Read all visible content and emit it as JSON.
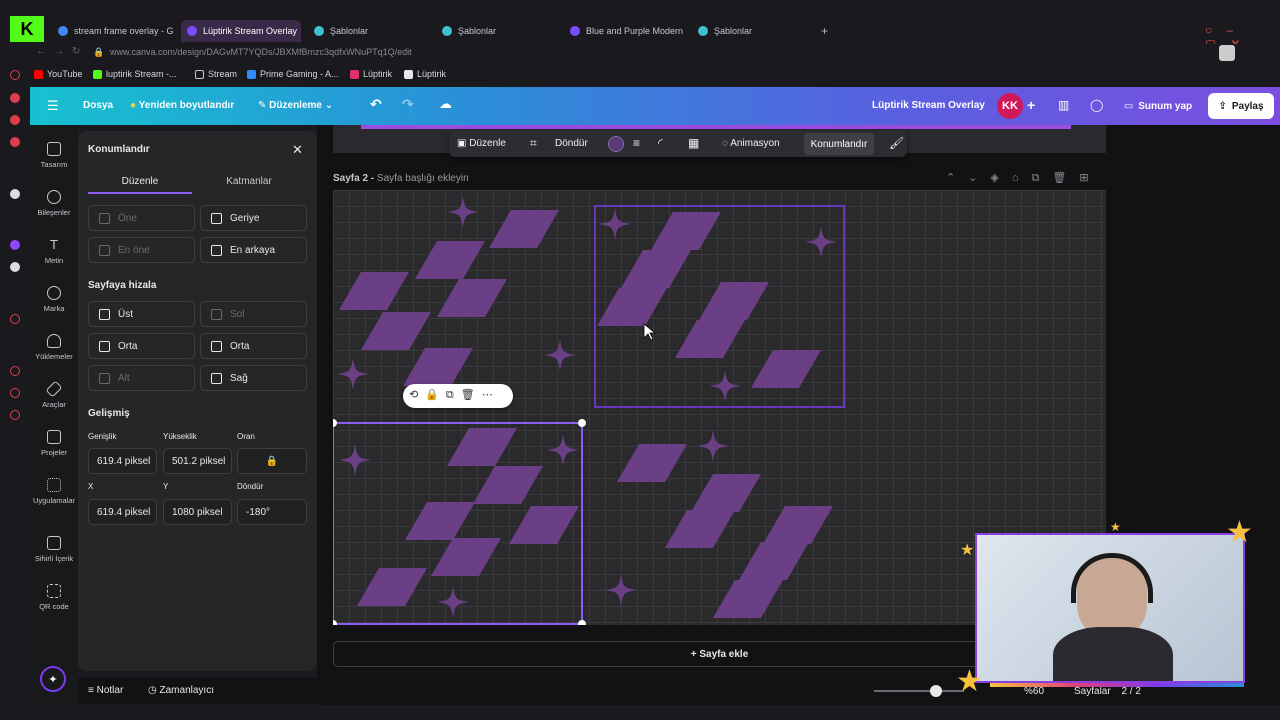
{
  "browser": {
    "tabs": [
      {
        "label": "stream frame overlay - G",
        "color": "#4285f4"
      },
      {
        "label": "Lüptirik Stream Overlay",
        "color": "#7c4dff",
        "active": true
      },
      {
        "label": "Şablonlar",
        "color": "#3fc1d3"
      },
      {
        "label": "Şablonlar",
        "color": "#3fc1d3"
      },
      {
        "label": "Blue and Purple Modern",
        "color": "#7c4dff"
      },
      {
        "label": "Şablonlar",
        "color": "#3fc1d3"
      }
    ],
    "url": "www.canva.com/design/DAGvMT7YQDs/JBXMfBmzc3qdfxWNuPTq1Q/edit",
    "bookmarks": [
      {
        "label": "YouTube",
        "color": "#ff0000"
      },
      {
        "label": "luptirik Stream -...",
        "color": "#53fc18"
      },
      {
        "label": "Stream",
        "color": "#c8c8cc"
      },
      {
        "label": "Prime Gaming - A...",
        "color": "#2e8cff"
      },
      {
        "label": "Lüptirik",
        "color": "#e1306c"
      },
      {
        "label": "Lüptirik",
        "color": "#e8e8ea"
      }
    ]
  },
  "canva": {
    "menu": {
      "file": "Dosya",
      "resize": "Yeniden boyutlandır",
      "editing": "Düzenleme"
    },
    "design_title": "Lüptirik Stream Overlay",
    "avatar": "KK",
    "present": "Sunum yap",
    "share": "Paylaş",
    "nav": [
      "Tasarım",
      "Bileşenler",
      "Metin",
      "Marka",
      "Yüklemeler",
      "Araçlar",
      "Projeler",
      "Uygulamalar",
      "Sihirli İçerik",
      "QR code"
    ],
    "toolbar": {
      "edit": "Düzenle",
      "rotate": "Döndür",
      "animate": "Animasyon",
      "position": "Konumlandır",
      "fill_color": "#5b3a78"
    },
    "page_label": "Sayfa 2 -",
    "page_title_placeholder": "Sayfa başlığı ekleyin",
    "add_page": "+ Sayfa ekle",
    "notes": "Notlar",
    "timer": "Zamanlayıcı",
    "zoom": "%60",
    "pages_label": "Sayfalar",
    "pages_count": "2 / 2"
  },
  "panel": {
    "title": "Konumlandır",
    "tabs": [
      "Düzenle",
      "Katmanlar"
    ],
    "arrange": {
      "forward": "Öne",
      "backward": "Geriye",
      "to_front": "En öne",
      "to_back": "En arkaya"
    },
    "align_title": "Sayfaya hizala",
    "align": {
      "top": "Üst",
      "left": "Sol",
      "middle": "Orta",
      "center": "Orta",
      "bottom": "Alt",
      "right": "Sağ"
    },
    "advanced_title": "Gelişmiş",
    "labels": {
      "width": "Genişlik",
      "height": "Yükseklik",
      "ratio": "Oran",
      "x": "X",
      "y": "Y",
      "rotate": "Döndür"
    },
    "values": {
      "width": "619.4 piksel",
      "height": "501.2 piksel",
      "x": "619.4 piksel",
      "y": "1080 piksel",
      "rotate": "-180°"
    }
  },
  "colors": {
    "accent_purple": "#7c3aed",
    "shape_purple": "#6b3f86",
    "selection": "#8b5cf6"
  }
}
